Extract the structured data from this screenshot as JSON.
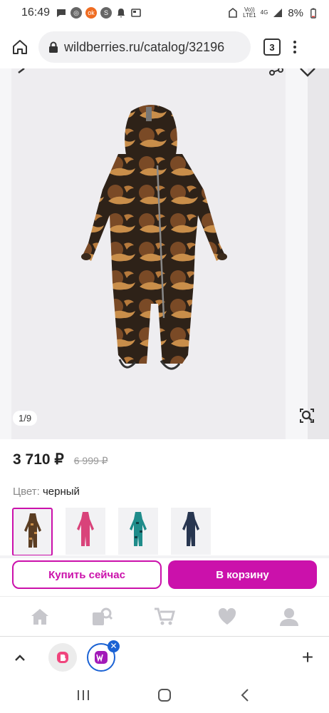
{
  "status_bar": {
    "time": "16:49",
    "network_top": "Vo))",
    "network_bottom": "LTE1",
    "signal": "4G",
    "battery": "8%"
  },
  "browser": {
    "url": "wildberries.ru/catalog/32196",
    "tab_count": "3"
  },
  "gallery": {
    "counter": "1/9"
  },
  "product": {
    "price": "3 710 ₽",
    "old_price": "6 999 ₽",
    "color_label": "Цвет:",
    "color_value": "черный",
    "swatches": [
      {
        "color": "#5a3d22",
        "selected": true
      },
      {
        "color": "#d9437a",
        "selected": false
      },
      {
        "color": "#1f8c8a",
        "selected": false
      },
      {
        "color": "#283650",
        "selected": false
      }
    ]
  },
  "actions": {
    "buy_now": "Купить сейчас",
    "add_to_cart": "В корзину"
  },
  "bottom_nav": {
    "items": [
      "home-icon",
      "catalog-search-icon",
      "cart-icon",
      "favorites-icon",
      "profile-icon"
    ]
  },
  "colors": {
    "accent": "#cb11ab",
    "tab_highlight": "#1a62d4"
  }
}
